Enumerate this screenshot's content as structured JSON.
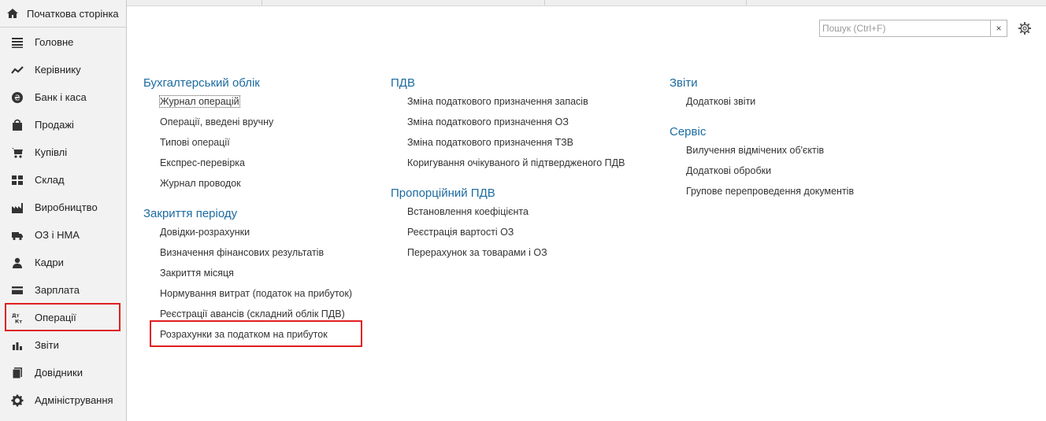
{
  "home": {
    "label": "Початкова сторінка",
    "icon": "home-icon"
  },
  "nav": [
    {
      "label": "Головне",
      "icon": "menu-lines-icon"
    },
    {
      "label": "Керівнику",
      "icon": "trend-icon"
    },
    {
      "label": "Банк і каса",
      "icon": "coin-icon"
    },
    {
      "label": "Продажі",
      "icon": "bag-icon"
    },
    {
      "label": "Купівлі",
      "icon": "cart-icon"
    },
    {
      "label": "Склад",
      "icon": "warehouse-icon"
    },
    {
      "label": "Виробництво",
      "icon": "factory-icon"
    },
    {
      "label": "ОЗ і НМА",
      "icon": "truck-icon"
    },
    {
      "label": "Кадри",
      "icon": "person-icon"
    },
    {
      "label": "Зарплата",
      "icon": "card-icon"
    },
    {
      "label": "Операції",
      "icon": "dt-kt-icon"
    },
    {
      "label": "Звіти",
      "icon": "bar-chart-icon"
    },
    {
      "label": "Довідники",
      "icon": "book-icon"
    },
    {
      "label": "Адміністрування",
      "icon": "gear-icon"
    }
  ],
  "search": {
    "placeholder": "Пошук (Ctrl+F)",
    "clear": "×"
  },
  "columns": [
    {
      "sections": [
        {
          "title": "Бухгалтерський облік",
          "links": [
            "Журнал операцій",
            "Операції, введені вручну",
            "Типові операції",
            "Експрес-перевірка",
            "Журнал проводок"
          ]
        },
        {
          "title": "Закриття періоду",
          "links": [
            "Довідки-розрахунки",
            "Визначення фінансових результатів",
            "Закриття місяця",
            "Нормування витрат (податок на прибуток)",
            "Реєстрації авансів (складний облік ПДВ)",
            "Розрахунки за податком на прибуток"
          ]
        }
      ]
    },
    {
      "sections": [
        {
          "title": "ПДВ",
          "links": [
            "Зміна податкового призначення запасів",
            "Зміна податкового призначення ОЗ",
            "Зміна податкового призначення ТЗВ",
            "Коригування очікуваного й підтвердженого ПДВ"
          ]
        },
        {
          "title": "Пропорційний ПДВ",
          "links": [
            "Встановлення коефіцієнта",
            "Реєстрація вартості ОЗ",
            "Перерахунок за товарами і ОЗ"
          ]
        }
      ]
    },
    {
      "sections": [
        {
          "title": "Звіти",
          "links": [
            "Додаткові звіти"
          ]
        },
        {
          "title": "Сервіс",
          "links": [
            "Вилучення відмічених об'єктів",
            "Додаткові обробки",
            "Групове перепроведення документів"
          ]
        }
      ]
    }
  ],
  "colors": {
    "section_title": "#1c6ba0",
    "highlight": "#e02020"
  }
}
